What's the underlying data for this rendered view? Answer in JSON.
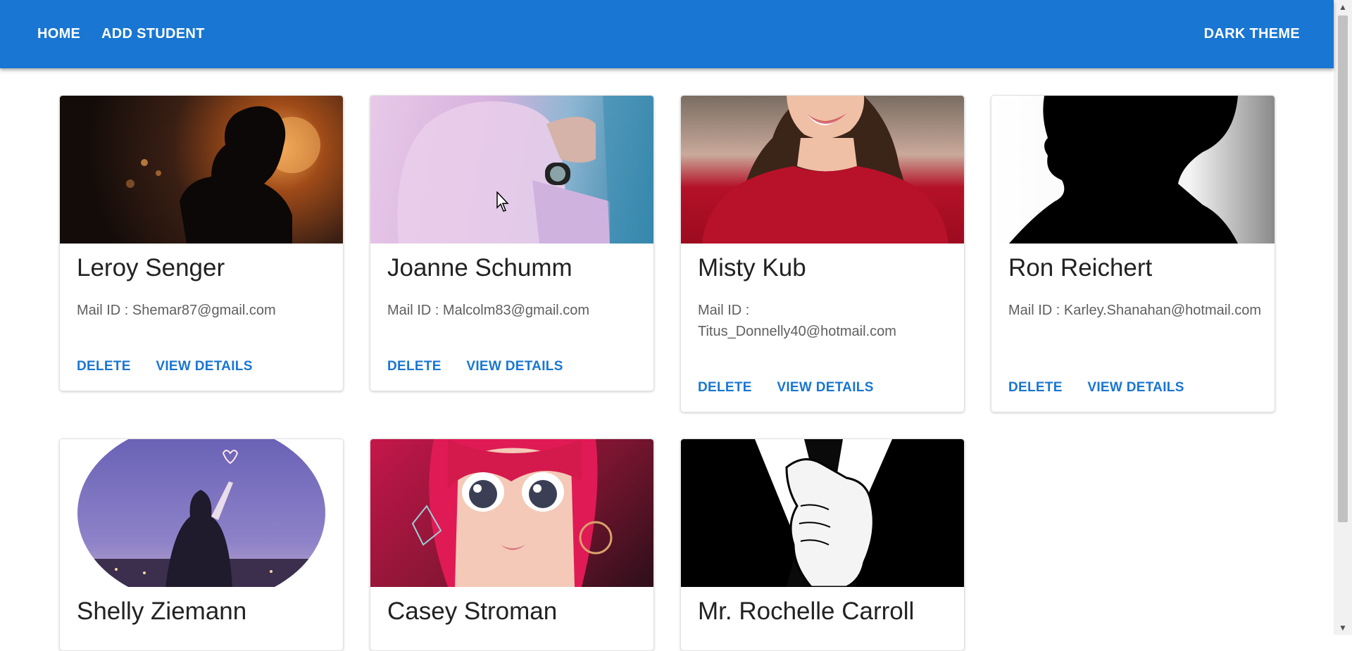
{
  "nav": {
    "home": "HOME",
    "add_student": "ADD STUDENT",
    "dark_theme": "DARK THEME"
  },
  "students": [
    {
      "name": "Leroy Senger",
      "mail_label": "Mail ID : ",
      "email": "Shemar87@gmail.com",
      "delete": "DELETE",
      "view": "VIEW DETAILS"
    },
    {
      "name": "Joanne Schumm",
      "mail_label": "Mail ID : ",
      "email": "Malcolm83@gmail.com",
      "delete": "DELETE",
      "view": "VIEW DETAILS"
    },
    {
      "name": "Misty Kub",
      "mail_label": "Mail ID : ",
      "email": "Titus_Donnelly40@hotmail.com",
      "delete": "DELETE",
      "view": "VIEW DETAILS"
    },
    {
      "name": "Ron Reichert",
      "mail_label": "Mail ID : ",
      "email": "Karley.Shanahan@hotmail.com",
      "delete": "DELETE",
      "view": "VIEW DETAILS"
    },
    {
      "name": "Shelly Ziemann"
    },
    {
      "name": "Casey Stroman"
    },
    {
      "name": "Mr. Rochelle Carroll"
    }
  ],
  "colors": {
    "appbar": "#1976d2",
    "action_text": "#1976d2"
  }
}
